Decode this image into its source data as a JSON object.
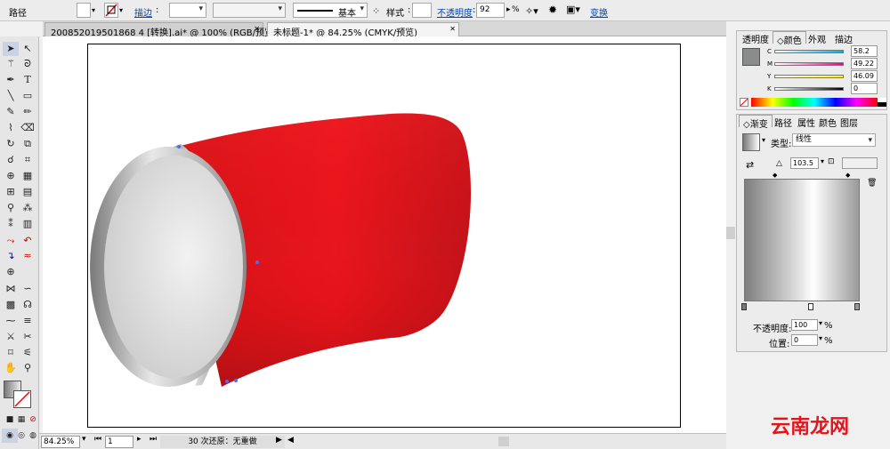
{
  "control_bar": {
    "object_type": "路径",
    "stroke_label": "描边",
    "stroke_profile": "基本",
    "style_label": "样式",
    "opacity_label": "不透明度",
    "opacity_value": "92",
    "percent": "%",
    "transform_label": "变换"
  },
  "tabs": [
    {
      "label": "200852019501868 4 [转换].ai* @ 100% (RGB/预览)"
    },
    {
      "label": "未标题-1* @ 84.25% (CMYK/预览)"
    }
  ],
  "tab_close": "✕",
  "status_bar": {
    "zoom": "84.25%",
    "artboard": "1",
    "undo_text": "30 次还原：无重做"
  },
  "color_panel": {
    "tabs": [
      "透明度",
      "颜色",
      "外观",
      "描边"
    ],
    "channels": [
      {
        "label": "C",
        "value": "58.2"
      },
      {
        "label": "M",
        "value": "49.22"
      },
      {
        "label": "Y",
        "value": "46.09"
      },
      {
        "label": "K",
        "value": "0"
      }
    ]
  },
  "gradient_panel": {
    "tabs": [
      "渐变",
      "路径",
      "属性",
      "颜色",
      "图层"
    ],
    "type_label": "类型:",
    "type_value": "线性",
    "angle_value": "103.5",
    "opacity_label": "不透明度:",
    "opacity_value": "100",
    "location_label": "位置:",
    "location_value": "0",
    "percent": "%"
  },
  "watermark": "云南龙网",
  "colors": {
    "can_red": "#e5141b",
    "can_dark": "#b8141b",
    "accent_link": "#0645ad"
  }
}
